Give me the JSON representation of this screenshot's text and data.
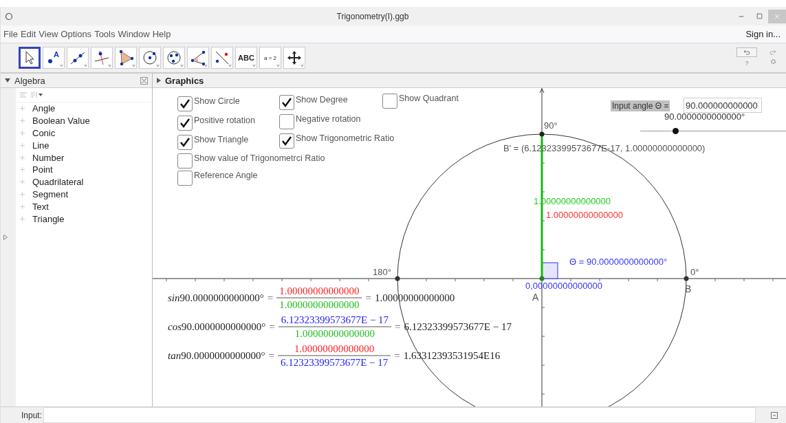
{
  "window": {
    "title": "Trigonometry(I).ggb"
  },
  "menu": {
    "items": [
      "File",
      "Edit",
      "View",
      "Options",
      "Tools",
      "Window",
      "Help"
    ],
    "sign_in": "Sign in..."
  },
  "toolbar": {
    "tools": [
      {
        "kind": "move",
        "selected": true
      },
      {
        "kind": "point",
        "selected": false,
        "label": "A"
      },
      {
        "kind": "line",
        "selected": false
      },
      {
        "kind": "perpendicular",
        "selected": false
      },
      {
        "kind": "polygon",
        "selected": false
      },
      {
        "kind": "circle",
        "selected": false
      },
      {
        "kind": "circle3",
        "selected": false
      },
      {
        "kind": "angle",
        "selected": false
      },
      {
        "kind": "reflect",
        "selected": false
      },
      {
        "kind": "text",
        "selected": false,
        "label": "ABC"
      },
      {
        "kind": "slider",
        "selected": false,
        "label": "a = 2"
      },
      {
        "kind": "pan",
        "selected": false
      }
    ],
    "help": "?"
  },
  "algebra": {
    "title": "Algebra",
    "items": [
      {
        "label": "Angle",
        "expanded": false
      },
      {
        "label": "Boolean Value",
        "expanded": false
      },
      {
        "label": "Conic",
        "expanded": false
      },
      {
        "label": "Line",
        "expanded": false
      },
      {
        "label": "Number",
        "expanded": false
      },
      {
        "label": "Point",
        "expanded": false
      },
      {
        "label": "Quadrilateral",
        "expanded": false
      },
      {
        "label": "Segment",
        "expanded": false
      },
      {
        "label": "Text",
        "expanded": false
      },
      {
        "label": "Triangle",
        "expanded": false
      }
    ]
  },
  "graphics": {
    "title": "Graphics",
    "checkboxes": [
      {
        "label": "Show Circle",
        "checked": true
      },
      {
        "label": "Positive rotation",
        "checked": true
      },
      {
        "label": "Show Triangle",
        "checked": true
      },
      {
        "label": "Show value of Trigonometrci Ratio",
        "checked": false
      },
      {
        "label": "Reference Angle",
        "checked": false
      },
      {
        "label": "Show Degree",
        "checked": true
      },
      {
        "label": "Negative rotation",
        "checked": false
      },
      {
        "label": "Show Trigonometric Ratio",
        "checked": true
      },
      {
        "label": "Show Quadrant",
        "checked": false
      }
    ],
    "input_angle": {
      "label": "Input angle Θ =",
      "value": "90.000000000000"
    },
    "slider": {
      "reading": "90.0000000000000°",
      "level": 0.24
    },
    "labels": [
      {
        "kind": "plain",
        "text": "90°"
      },
      {
        "kind": "plain",
        "text": "B' = (6.12323399573677E-17, 1.00000000000000)"
      },
      {
        "kind": "green",
        "text": "1.00000000000000"
      },
      {
        "kind": "red",
        "text": "1.00000000000000"
      },
      {
        "kind": "blue",
        "text": "Θ = 90.0000000000000°"
      },
      {
        "kind": "plain",
        "text": "180°"
      },
      {
        "kind": "plain",
        "text": "0°"
      },
      {
        "kind": "blue",
        "text": "0,00000000000000"
      },
      {
        "kind": "point",
        "text": "A"
      },
      {
        "kind": "point",
        "text": "B"
      }
    ],
    "formulas": [
      {
        "function": "sin",
        "angle": "90.0000000000000°",
        "equals": "=",
        "numerator": {
          "text": "1.00000000000000",
          "color": "#ff2020"
        },
        "denominator": {
          "text": "1.00000000000000",
          "color": "#20c020"
        },
        "result": "1.00000000000000"
      },
      {
        "function": "cos",
        "angle": "90.0000000000000°",
        "equals": "=",
        "numerator": {
          "text": "6.12323399573677E − 17",
          "color": "#2020ff"
        },
        "denominator": {
          "text": "1.00000000000000",
          "color": "#20c020"
        },
        "result": "6.12323399573677E − 17"
      },
      {
        "function": "tan",
        "angle": "90.0000000000000°",
        "equals": "=",
        "numerator": {
          "text": "1.00000000000000",
          "color": "#ff2020"
        },
        "denominator": {
          "text": "6.12323399573677E − 17",
          "color": "#2020ff"
        },
        "result": "1.63312393531954E16"
      }
    ]
  },
  "input_bar": {
    "label": "Input:"
  }
}
